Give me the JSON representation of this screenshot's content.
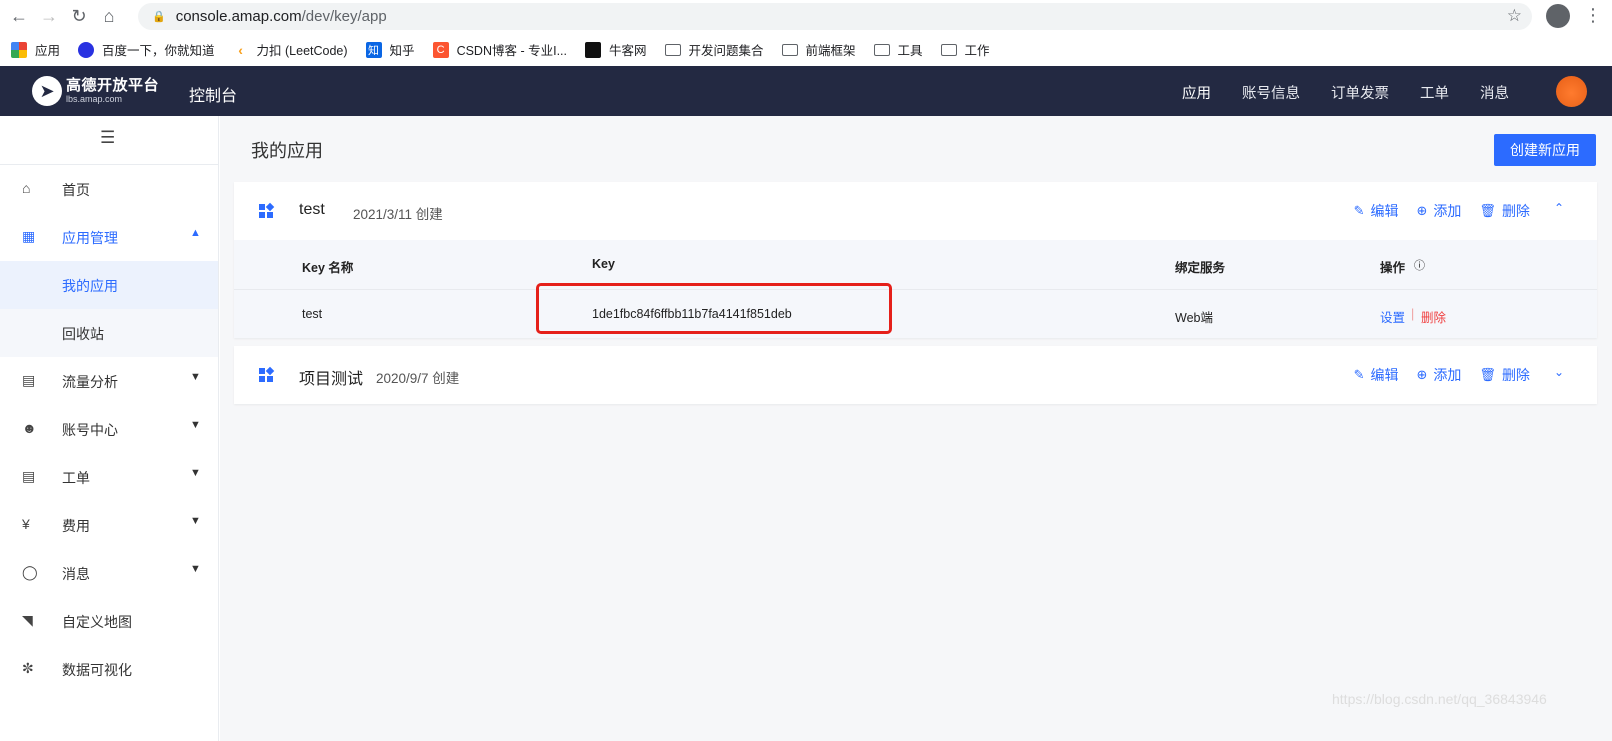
{
  "browser": {
    "url_host": "console.amap.com",
    "url_path": "/dev/key/app"
  },
  "bookmarks": [
    {
      "label": "应用",
      "icon": "apps-grid-icon"
    },
    {
      "label": "百度一下，你就知道",
      "icon": "baidu-icon"
    },
    {
      "label": "力扣 (LeetCode)",
      "icon": "leetcode-icon"
    },
    {
      "label": "知乎",
      "icon": "zhihu-icon",
      "glyph": "知"
    },
    {
      "label": "CSDN博客 - 专业I...",
      "icon": "csdn-icon",
      "glyph": "C"
    },
    {
      "label": "牛客网",
      "icon": "nowcoder-icon"
    },
    {
      "label": "开发问题集合",
      "icon": "folder-icon"
    },
    {
      "label": "前端框架",
      "icon": "folder-icon"
    },
    {
      "label": "工具",
      "icon": "folder-icon"
    },
    {
      "label": "工作",
      "icon": "folder-icon"
    }
  ],
  "topnav": {
    "logo_title": "高德开放平台",
    "logo_sub": "lbs.amap.com",
    "console": "控制台",
    "links": [
      "应用",
      "账号信息",
      "订单发票",
      "工单",
      "消息"
    ]
  },
  "sidebar": {
    "items": [
      {
        "label": "首页",
        "icon": "home-icon"
      },
      {
        "label": "应用管理",
        "icon": "grid-icon"
      },
      {
        "label": "我的应用"
      },
      {
        "label": "回收站"
      },
      {
        "label": "流量分析",
        "icon": "chart-icon"
      },
      {
        "label": "账号中心",
        "icon": "user-icon"
      },
      {
        "label": "工单",
        "icon": "ticket-icon"
      },
      {
        "label": "费用",
        "icon": "yuan-icon"
      },
      {
        "label": "消息",
        "icon": "message-icon"
      },
      {
        "label": "自定义地图",
        "icon": "map-icon"
      },
      {
        "label": "数据可视化",
        "icon": "data-vis-icon"
      }
    ]
  },
  "main": {
    "title": "我的应用",
    "create_button": "创建新应用",
    "actions": {
      "edit": "编辑",
      "add": "添加",
      "delete": "删除"
    },
    "apps": [
      {
        "name": "test",
        "date": "2021/3/11 创建",
        "expanded": true,
        "table": {
          "headers": [
            "Key 名称",
            "Key",
            "绑定服务",
            "操作"
          ],
          "rows": [
            {
              "key_name": "test",
              "key": "1de1fbc84f6ffbb11b7fa4141f851deb",
              "service": "Web端",
              "op_set": "设置",
              "op_delete": "删除"
            }
          ]
        }
      },
      {
        "name": "项目测试",
        "date": "2020/9/7 创建",
        "expanded": false
      }
    ]
  },
  "watermark": "https://blog.csdn.net/qq_36843946",
  "colors": {
    "accent": "#2c6bff",
    "topbar": "#232942",
    "danger": "#f04040",
    "highlight": "#e5201a"
  }
}
